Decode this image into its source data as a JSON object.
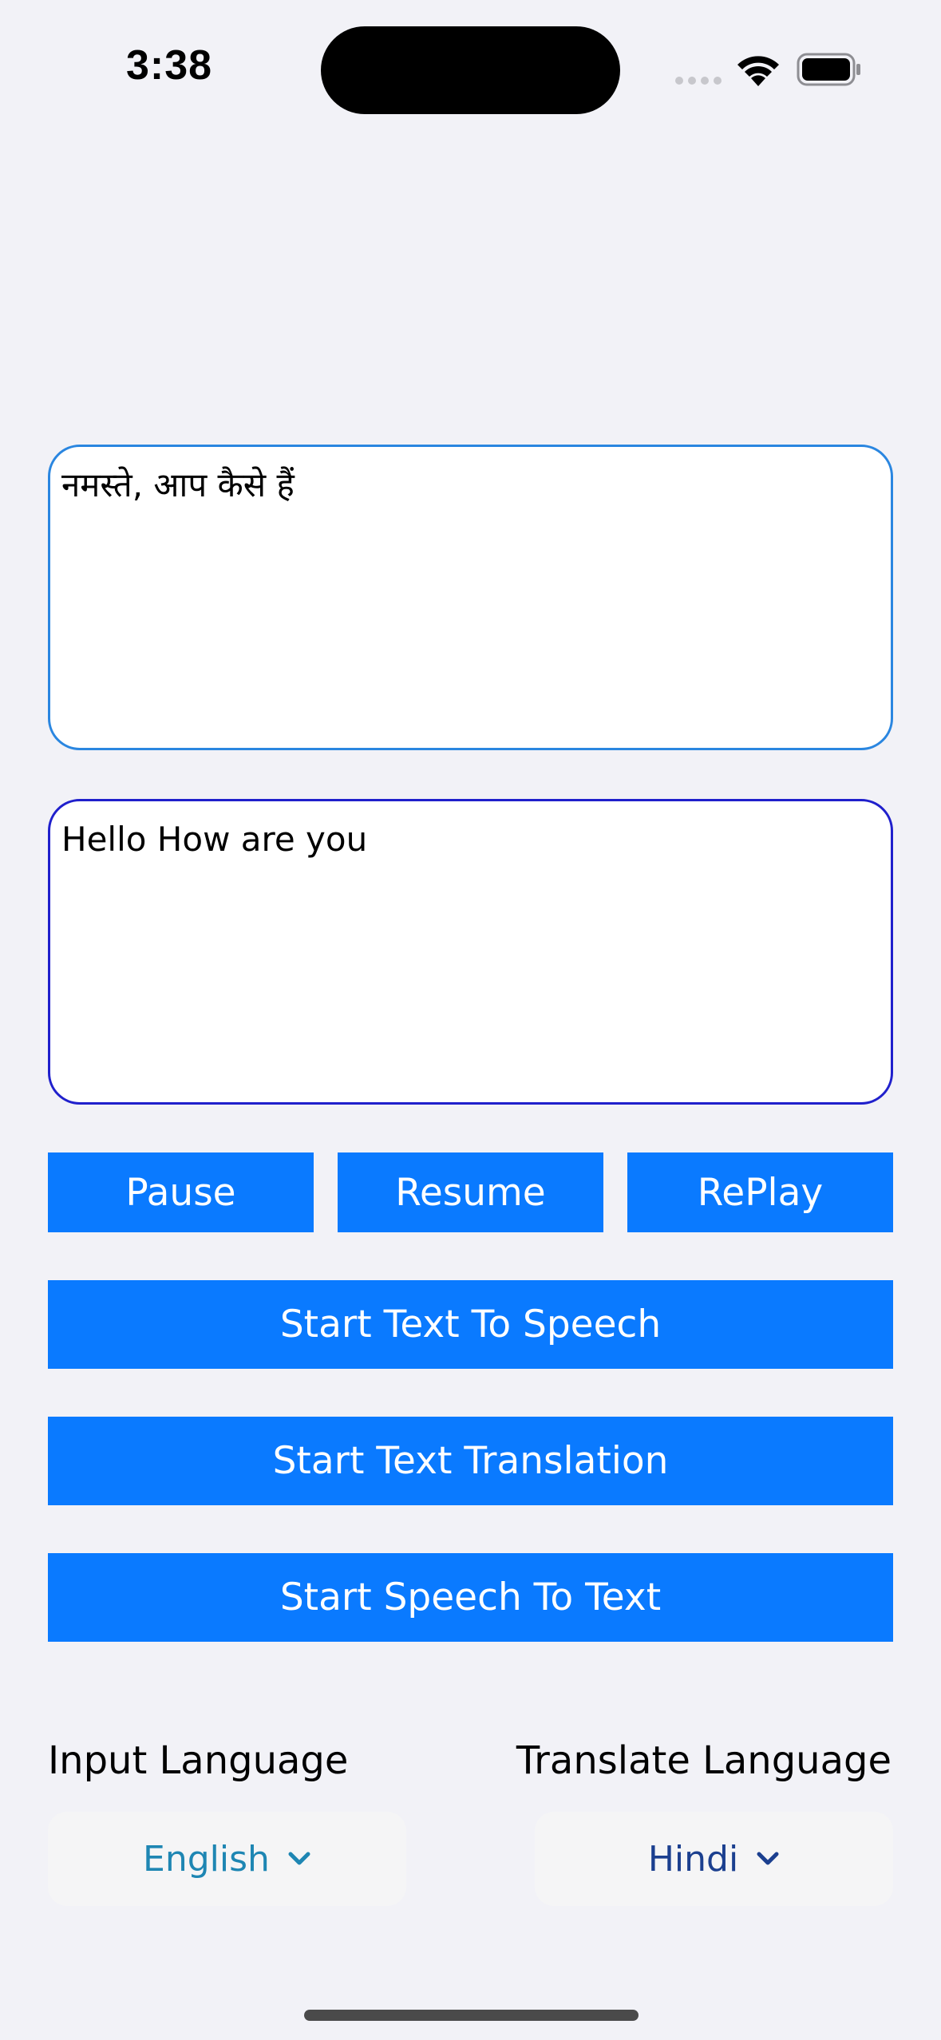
{
  "status_bar": {
    "time": "3:38"
  },
  "source_text": "नमस्ते, आप कैसे हैं",
  "translated_text": "Hello How are you",
  "controls": {
    "pause_label": "Pause",
    "resume_label": "Resume",
    "replay_label": "RePlay",
    "tts_label": "Start Text To Speech",
    "translate_label": "Start Text Translation",
    "stt_label": "Start Speech To Text"
  },
  "languages": {
    "input_label": "Input Language",
    "input_value": "English",
    "translate_label": "Translate Language",
    "translate_value": "Hindi"
  },
  "colors": {
    "background": "#f2f2f7",
    "button": "#0a7aff",
    "source_border": "#2a86e0",
    "target_border": "#2020cc",
    "input_picker_text": "#1e86b3",
    "translate_picker_text": "#1b3f8f"
  },
  "icons": [
    "signal-icon",
    "wifi-icon",
    "battery-icon",
    "chevron-down-icon"
  ]
}
